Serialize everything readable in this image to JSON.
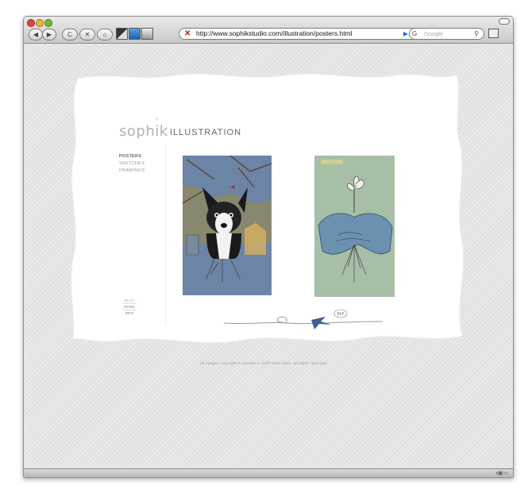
{
  "browser": {
    "nav_buttons": {
      "back": "◀",
      "forward": "▶",
      "reload": "C",
      "stop": "✕",
      "home": "⌂"
    },
    "url": "http://www.sophikstudio.com/illustration/posters.html",
    "search_placeholder": "Google",
    "search_engine_letter": "G"
  },
  "site": {
    "logo": "sophik",
    "section_title": "ILLUSTRATION",
    "nav": [
      "POSTERS",
      "SKETCHES",
      "DRAWINGS"
    ],
    "active_nav": "POSTERS",
    "bottom_nav": {
      "top": "BLOG",
      "more": "MORE",
      "info": "INFO"
    },
    "fly_label": "FLY",
    "copyright": "all images copyright © jennifer a. korff 2000-2012. all rights reserved."
  },
  "colors": {
    "poster1_bg": "#6c84a6",
    "poster2_bg": "#a6bfa6",
    "accent": "#b05a40",
    "bird": "#3f5f94"
  },
  "icons": [
    "back-icon",
    "forward-icon",
    "reload-icon",
    "stop-icon",
    "home-icon",
    "bookmark-icon",
    "rss-icon",
    "search-icon",
    "tabs-icon",
    "bird-icon"
  ]
}
